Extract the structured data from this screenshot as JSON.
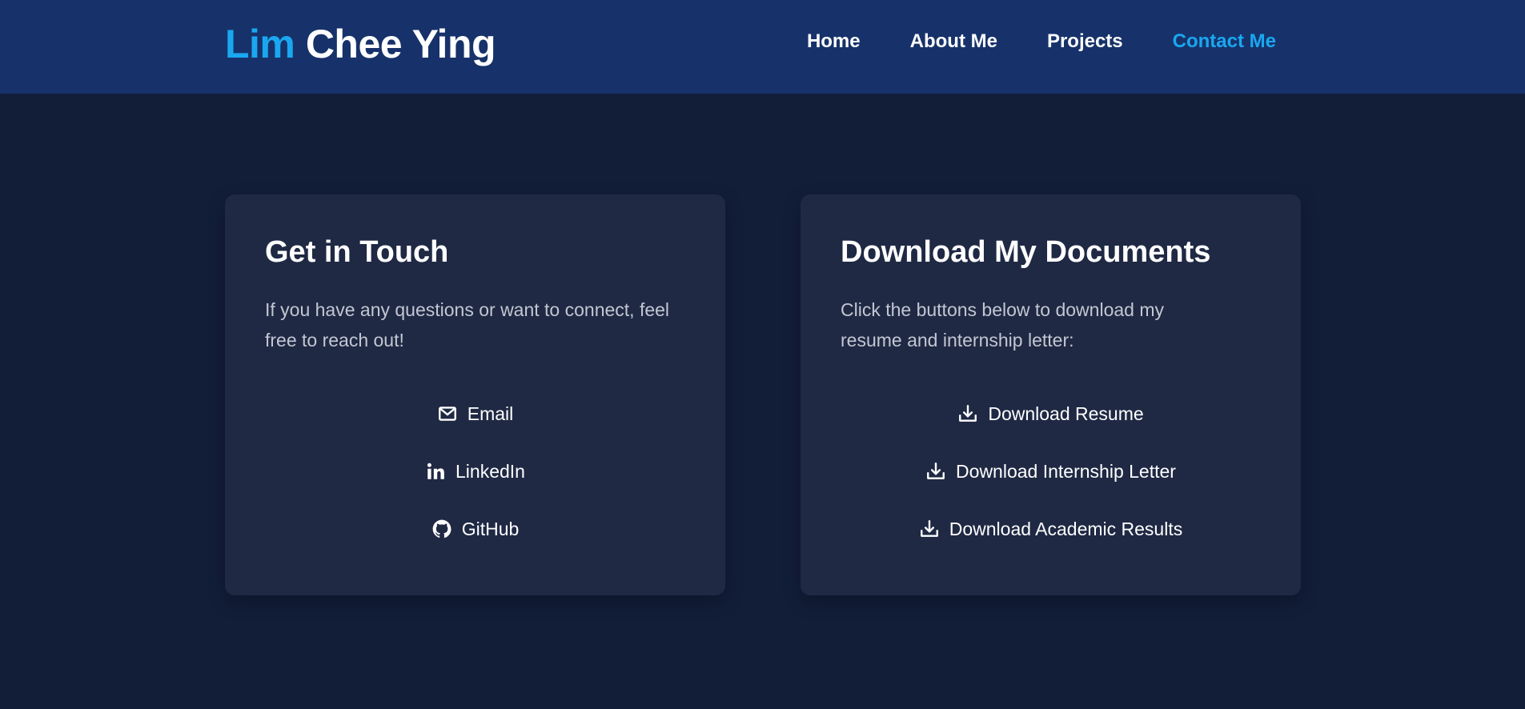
{
  "header": {
    "brand_first": "Lim",
    "brand_last": "Chee Ying",
    "nav": [
      {
        "label": "Home",
        "active": false
      },
      {
        "label": "About Me",
        "active": false
      },
      {
        "label": "Projects",
        "active": false
      },
      {
        "label": "Contact Me",
        "active": true
      }
    ]
  },
  "contact_card": {
    "title": "Get in Touch",
    "description": "If you have any questions or want to connect, feel free to reach out!",
    "links": [
      {
        "label": "Email",
        "icon": "mail-icon"
      },
      {
        "label": "LinkedIn",
        "icon": "linkedin-icon"
      },
      {
        "label": "GitHub",
        "icon": "github-icon"
      }
    ]
  },
  "documents_card": {
    "title": "Download My Documents",
    "description": "Click the buttons below to download my resume and internship letter:",
    "links": [
      {
        "label": "Download Resume",
        "icon": "download-icon"
      },
      {
        "label": "Download Internship Letter",
        "icon": "download-icon"
      },
      {
        "label": "Download Academic Results",
        "icon": "download-icon"
      }
    ]
  },
  "colors": {
    "accent": "#1aa7f0",
    "header_bg": "#17326a",
    "page_bg": "#121d38",
    "card_bg": "#1f2944"
  }
}
